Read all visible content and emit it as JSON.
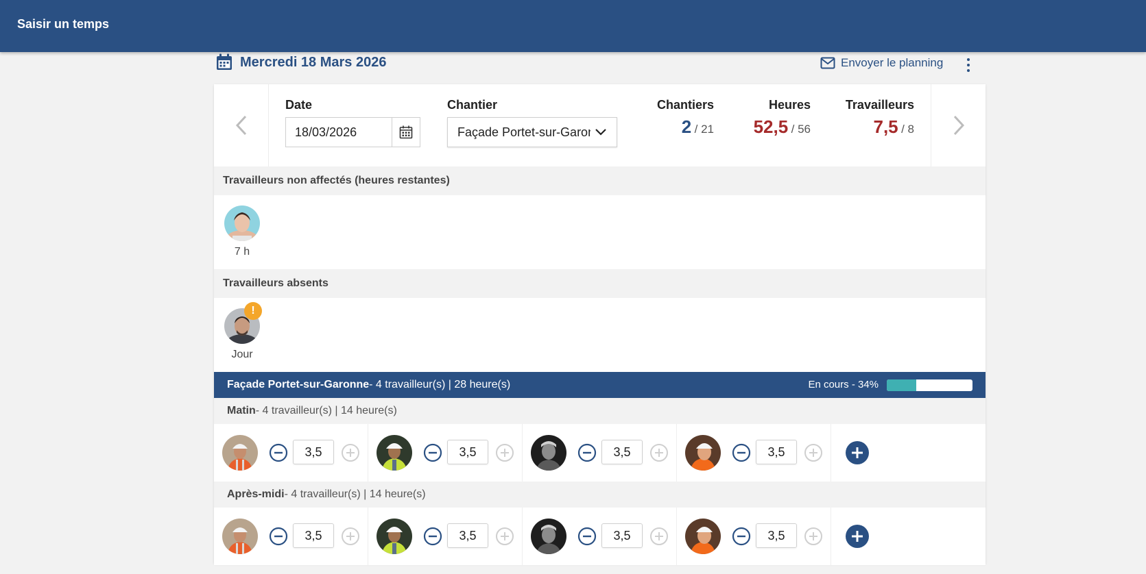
{
  "app": {
    "title": "Saisir un temps"
  },
  "header": {
    "date_label": "Mercredi 18 Mars 2026",
    "send_planning": "Envoyer le planning"
  },
  "filters": {
    "date_label": "Date",
    "date_value": "18/03/2026",
    "site_label": "Chantier",
    "site_value": "Façade Portet-sur-Garonne"
  },
  "stats": {
    "sites": {
      "label": "Chantiers",
      "value": "2",
      "total": "/ 21"
    },
    "hours": {
      "label": "Heures",
      "value": "52,5",
      "total": "/ 56"
    },
    "workers": {
      "label": "Travailleurs",
      "value": "7,5",
      "total": "/ 8"
    }
  },
  "unassigned": {
    "title": "Travailleurs non affectés (heures restantes)",
    "workers": [
      {
        "hours": "7 h"
      }
    ]
  },
  "absent": {
    "title": "Travailleurs absents",
    "workers": [
      {
        "period": "Jour",
        "badge": "!"
      }
    ]
  },
  "site": {
    "name": "Façade Portet-sur-Garonne",
    "summary": " - 4 travailleur(s) | 28 heure(s)",
    "status": "En cours - 34%",
    "progress": 0.34
  },
  "periods": [
    {
      "name": "Matin",
      "summary": " - 4 travailleur(s) | 14 heure(s)",
      "entries": [
        "3,5",
        "3,5",
        "3,5",
        "3,5"
      ]
    },
    {
      "name": "Après-midi",
      "summary": " - 4 travailleur(s) | 14 heure(s)",
      "entries": [
        "3,5",
        "3,5",
        "3,5",
        "3,5"
      ]
    }
  ],
  "colors": {
    "primary": "#2a5083",
    "accent_red": "#a52a2a",
    "warning": "#f4a62a",
    "progress": "#3fb0b2"
  }
}
